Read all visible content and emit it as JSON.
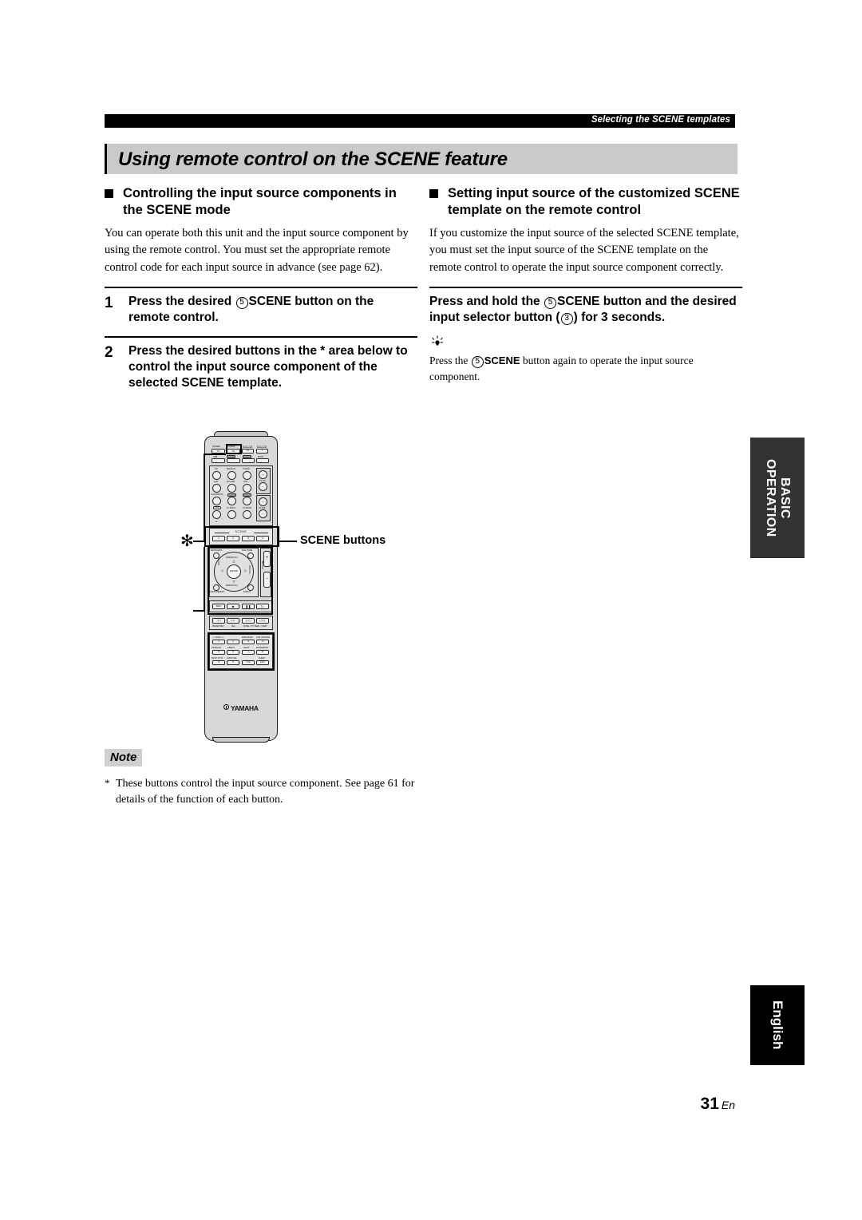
{
  "header": {
    "running_head": "Selecting the SCENE templates"
  },
  "section": {
    "title": "Using remote control on the SCENE feature"
  },
  "left_column": {
    "subhead": "Controlling the input source components in the SCENE mode",
    "paragraph": "You can operate both this unit and the input source component by using the remote control. You must set the appropriate remote control code for each input source in advance (see page 62).",
    "steps": [
      {
        "number": "1",
        "text_before": "Press the desired",
        "circle": "5",
        "bold_word": "SCENE",
        "text_after": "button on the remote control."
      },
      {
        "number": "2",
        "text": "Press the desired buttons in the * area below to control the input source component of the selected SCENE template."
      }
    ]
  },
  "right_column": {
    "subhead": "Setting input source of the customized SCENE template on the remote control",
    "paragraph": "If you customize the input source of the selected SCENE template, you must set the input source of the SCENE template on the remote control to operate the input source component correctly.",
    "step": {
      "text_before": "Press and hold the",
      "circle": "5",
      "bold_word": "SCENE",
      "text_mid": "button and the desired input selector button (",
      "circle2": "3",
      "text_after": ") for 3 seconds."
    },
    "tip": {
      "glyph": "☀",
      "text_before": "Press the",
      "circle": "5",
      "bold_word": "SCENE",
      "text_after": "button again to operate the input source component."
    }
  },
  "figure": {
    "callout": "SCENE buttons",
    "star": "✻",
    "brand": "YAMAHA",
    "scene_header": "SCENE",
    "scene_buttons": [
      "1",
      "2",
      "3",
      "4"
    ],
    "power_row": [
      {
        "top": "POWER",
        "label": "TV"
      },
      {
        "top": "POWER",
        "label": "AV"
      },
      {
        "top": "POWER",
        "label": "⏻"
      },
      {
        "top": "POWER",
        "label": "I"
      }
    ],
    "row2": [
      "USB",
      "A",
      "B",
      "MUTE"
    ],
    "source_grid": [
      [
        "CD",
        "MD/CD-R",
        "TUNER"
      ],
      [
        "DVD",
        "DTV/CBL",
        "DVR"
      ],
      [
        "V-AUX/DOCK",
        "",
        ""
      ],
      [
        "SEP",
        "TV INPUT",
        "TV MUTE"
      ]
    ],
    "tv_cluster": [
      "TV CH",
      "TV VOL"
    ],
    "volume_label": "VOLUME",
    "dpad": {
      "center": "ENTER",
      "up": "PRESET/CH",
      "down": "PRESET/CH",
      "left": "A/B/C/D/E",
      "right": "A/B/C/D/E",
      "tl": "BAND/LEVEL",
      "tr": "SUR. MODE",
      "bl": "AUDIO/MEMORY",
      "br": "DISPLAY"
    },
    "transport": [
      "REC",
      "■",
      "❚❚",
      "▷"
    ],
    "skip_row": [
      "◁◁",
      "▷▷",
      "|◁◁",
      "▷▷|"
    ],
    "skip_row_labels": [
      "PRESET/SET",
      "SEA",
      "MODE - PTY SEEK - START"
    ],
    "keypad_headers": [
      "-/-- PROG +/--",
      "ENHANCER",
      "SUR. DECODE",
      "STRAIGHT",
      "DIRECT",
      "NIGHT",
      "PARAMETER",
      "MULTI CH IN",
      "AUDIO SEL",
      "SLEEP"
    ],
    "keypad": [
      [
        "1",
        "2",
        "3",
        "4"
      ],
      [
        "5",
        "6",
        "7",
        "8"
      ],
      [
        "9",
        "0",
        "+10",
        "ENT"
      ]
    ]
  },
  "note": {
    "badge": "Note",
    "star": "*",
    "text": "These buttons control the input source component. See page 61 for details of the function of each button."
  },
  "side_tabs": {
    "basic": "BASIC OPERATION",
    "english": "English"
  },
  "page": {
    "number": "31",
    "suffix": "En"
  }
}
